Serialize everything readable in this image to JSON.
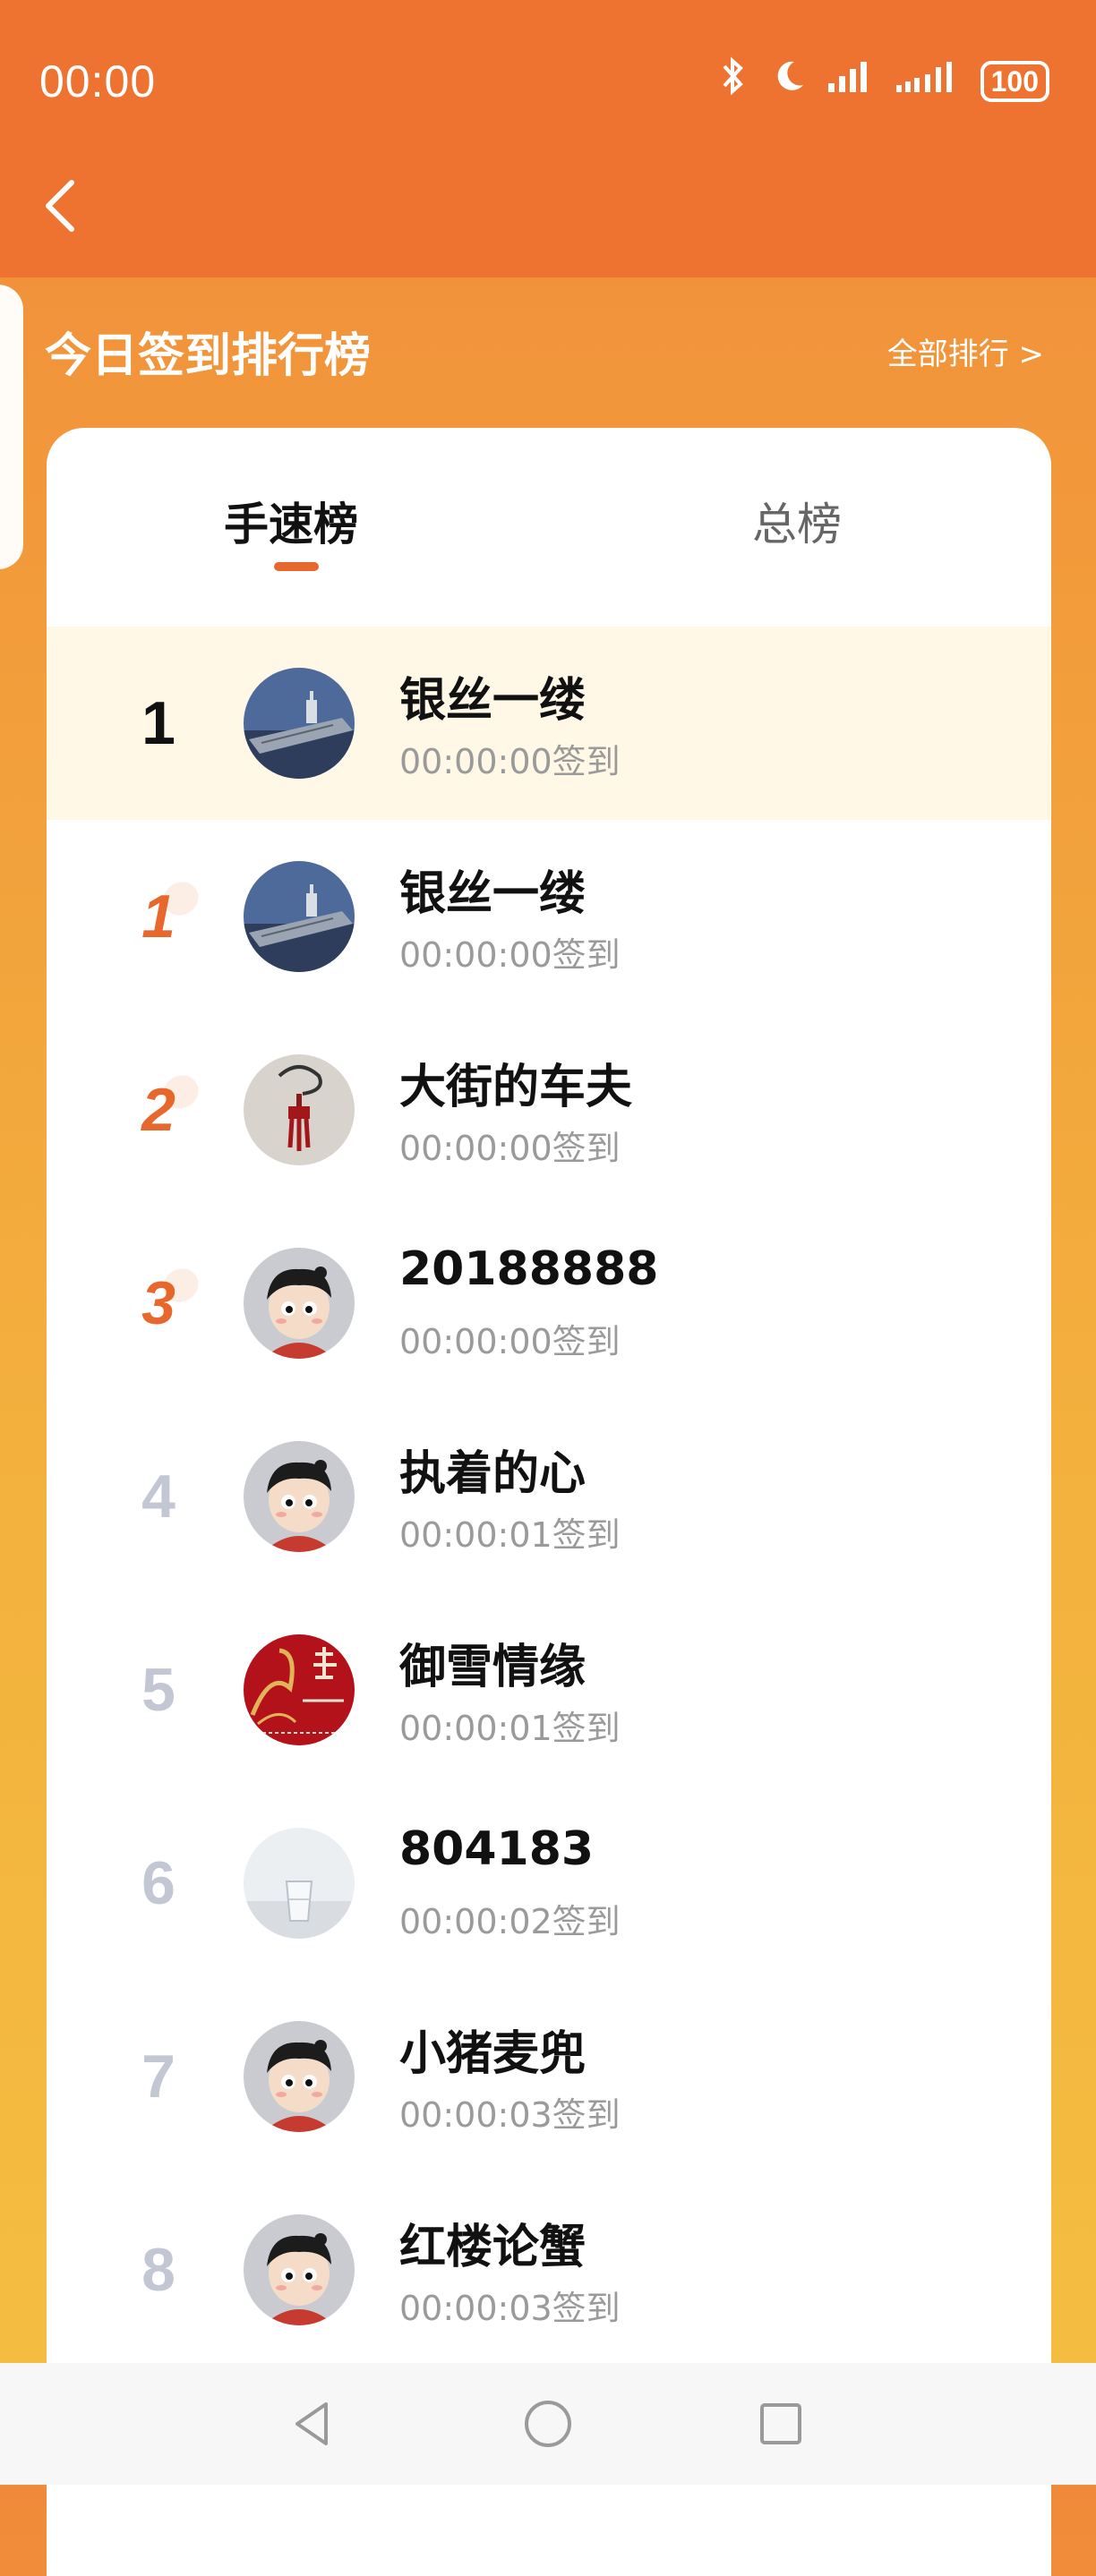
{
  "status_bar": {
    "time": "00:00",
    "battery": "100"
  },
  "header": {
    "section_title": "今日签到排行榜",
    "all_ranking_link": "全部排行 >"
  },
  "tabs": {
    "active": "手速榜",
    "inactive": "总榜"
  },
  "my_entry": {
    "rank": "1",
    "name": "银丝一缕",
    "time": "00:00:00签到",
    "avatar": "carrier"
  },
  "rows": [
    {
      "rank": "1",
      "name": "银丝一缕",
      "time": "00:00:00签到",
      "avatar": "carrier"
    },
    {
      "rank": "2",
      "name": "大街的车夫",
      "time": "00:00:00签到",
      "avatar": "ornament"
    },
    {
      "rank": "3",
      "name": "20188888",
      "time": "00:00:00签到",
      "avatar": "cartoon"
    },
    {
      "rank": "4",
      "name": "执着的心",
      "time": "00:00:01签到",
      "avatar": "cartoon"
    },
    {
      "rank": "5",
      "name": "御雪情缘",
      "time": "00:00:01签到",
      "avatar": "dragon-red"
    },
    {
      "rank": "6",
      "name": "804183",
      "time": "00:00:02签到",
      "avatar": "glass"
    },
    {
      "rank": "7",
      "name": "小猪麦兜",
      "time": "00:00:03签到",
      "avatar": "cartoon"
    },
    {
      "rank": "8",
      "name": "红楼论蟹",
      "time": "00:00:03签到",
      "avatar": "cartoon"
    }
  ],
  "colors": {
    "accent": "#e8672c",
    "header_bg": "#ee7230",
    "highlight_row": "#fff8e6"
  }
}
